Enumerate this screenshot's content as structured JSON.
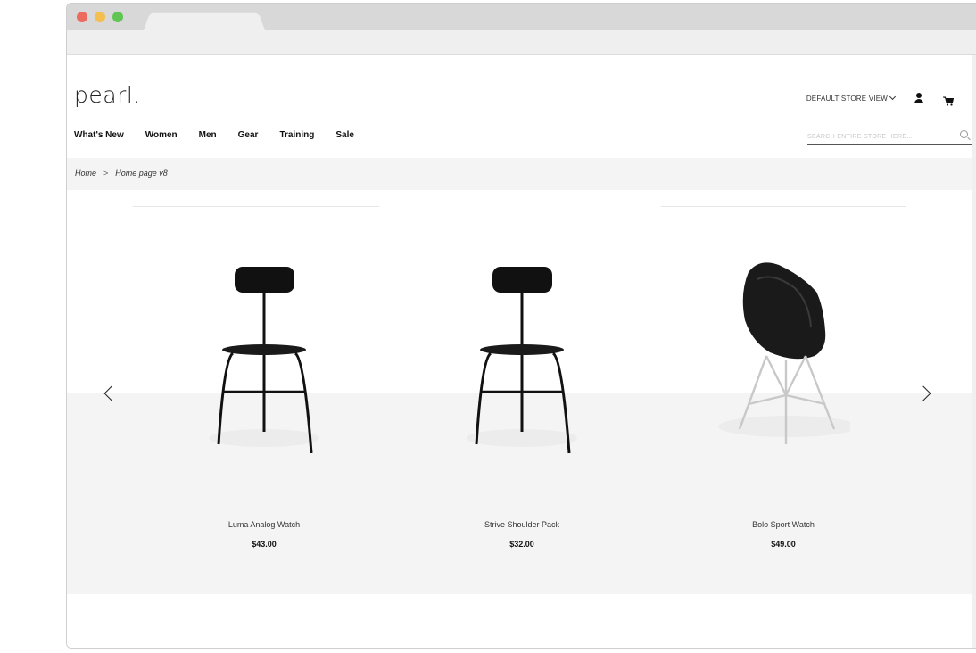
{
  "site": {
    "logo": "pearl.",
    "store_view": "DEFAULT STORE VIEW",
    "search_placeholder": "SEARCH ENTIRE STORE HERE..."
  },
  "nav": {
    "items": [
      "What's New",
      "Women",
      "Men",
      "Gear",
      "Training",
      "Sale"
    ]
  },
  "breadcrumb": {
    "home": "Home",
    "separator": ">",
    "current": "Home page v8"
  },
  "carousel": {
    "products": [
      {
        "name": "Luma Analog Watch",
        "price": "$43.00",
        "image": "black-stool-chair"
      },
      {
        "name": "Strive Shoulder Pack",
        "price": "$32.00",
        "image": "black-stool-chair"
      },
      {
        "name": "Bolo Sport Watch",
        "price": "$49.00",
        "image": "black-eiffel-armchair"
      }
    ]
  },
  "colors": {
    "window_close": "#ec6a5e",
    "window_minimize": "#f4bf4f",
    "window_maximize": "#61c554",
    "panel_gray": "#f4f4f4"
  }
}
